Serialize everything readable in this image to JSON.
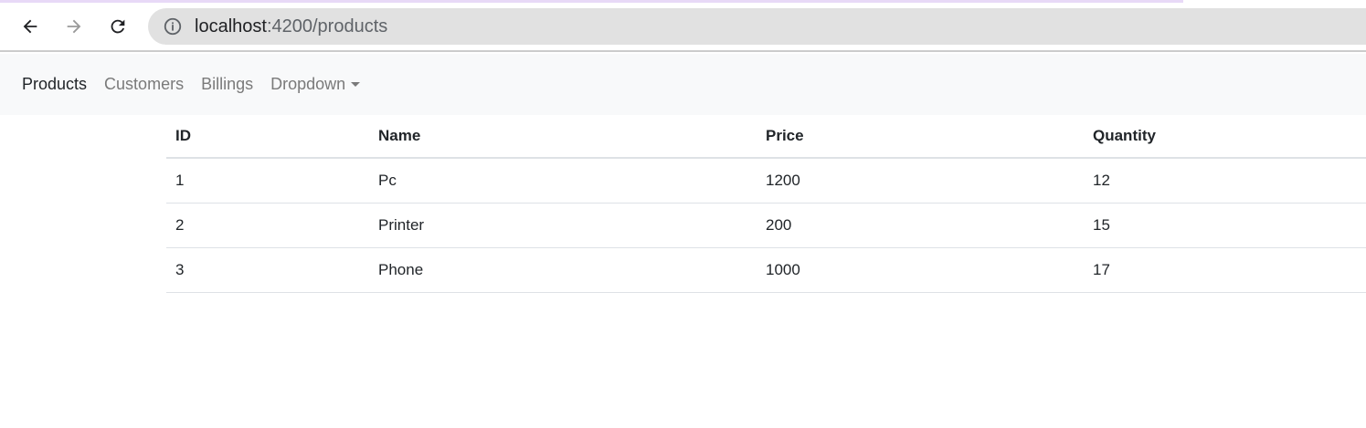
{
  "browser": {
    "url_host": "localhost",
    "url_path": ":4200/products"
  },
  "navbar": {
    "items": [
      {
        "label": "Products",
        "active": true
      },
      {
        "label": "Customers"
      },
      {
        "label": "Billings"
      },
      {
        "label": "Dropdown"
      }
    ]
  },
  "table": {
    "headers": [
      "ID",
      "Name",
      "Price",
      "Quantity"
    ],
    "rows": [
      [
        "1",
        "Pc",
        "1200",
        "12"
      ],
      [
        "2",
        "Printer",
        "200",
        "15"
      ],
      [
        "3",
        "Phone",
        "1000",
        "17"
      ]
    ]
  }
}
